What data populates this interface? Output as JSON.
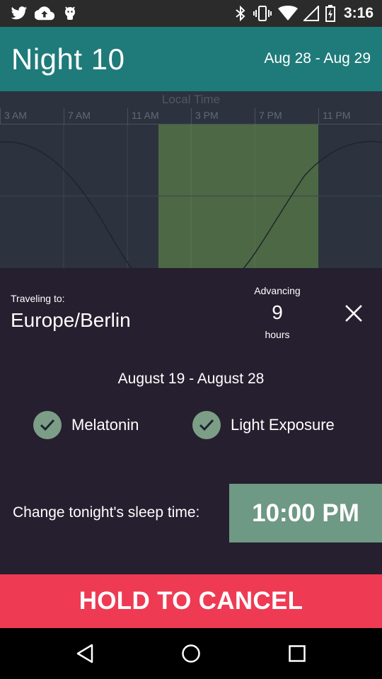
{
  "status_bar": {
    "time": "3:16",
    "icons": [
      "twitter-icon",
      "cloud-upload-icon",
      "android-icon",
      "bluetooth-icon",
      "vibrate-icon",
      "wifi-icon",
      "signal-icon",
      "battery-charging-icon"
    ]
  },
  "header": {
    "title": "Night 10",
    "date_range": "Aug 28 - Aug 29",
    "background": "#1f7b7a"
  },
  "chart": {
    "axis_title": "Local Time",
    "ticks": [
      "3 AM",
      "7 AM",
      "11 AM",
      "3 PM",
      "7 PM",
      "11 PM"
    ],
    "highlight_color": "#4e6c44"
  },
  "chart_data": {
    "type": "line",
    "title": "",
    "xlabel": "Local Time",
    "x_tick_labels": [
      "3 AM",
      "7 AM",
      "11 AM",
      "3 PM",
      "7 PM",
      "11 PM"
    ],
    "highlight_range": [
      "1 PM",
      "11 PM"
    ],
    "series": [
      {
        "curve": "sinusoid",
        "color": "#1e232b"
      }
    ]
  },
  "trip": {
    "traveling_label": "Traveling to:",
    "destination": "Europe/Berlin",
    "advancing_label": "Advancing",
    "advancing_value": "9",
    "advancing_unit": "hours"
  },
  "schedule": {
    "date_range": "August 19 - August 28",
    "items": [
      {
        "label": "Melatonin",
        "checked": true
      },
      {
        "label": "Light Exposure",
        "checked": true
      }
    ]
  },
  "sleep": {
    "label": "Change tonight's sleep time:",
    "time": "10:00 PM"
  },
  "cancel": {
    "label": "HOLD TO CANCEL",
    "color": "#ee3a53"
  },
  "nav": {
    "icons": [
      "back-icon",
      "home-icon",
      "recents-icon"
    ]
  }
}
